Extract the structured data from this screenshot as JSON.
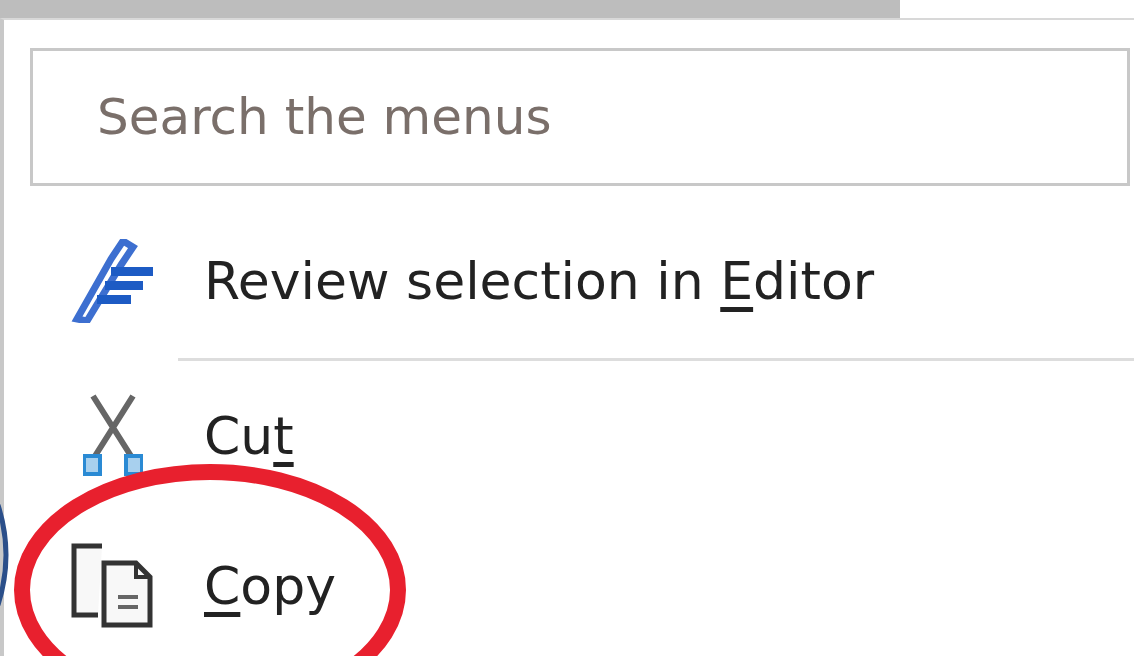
{
  "search": {
    "placeholder": "Search the menus"
  },
  "items": [
    {
      "kind": "editor",
      "label_before": "Review selection in ",
      "access_key": "E",
      "label_after": "ditor",
      "separator_after": true
    },
    {
      "kind": "cut",
      "label_before": "Cu",
      "access_key": "t",
      "separator_after": false
    },
    {
      "kind": "copy",
      "access_key": "C",
      "label_after": "opy",
      "separator_after": false
    }
  ],
  "annotations": [
    {
      "kind": "ellipse",
      "color": "#e8202e"
    },
    {
      "kind": "arc",
      "color": "#2b4f8a"
    }
  ]
}
